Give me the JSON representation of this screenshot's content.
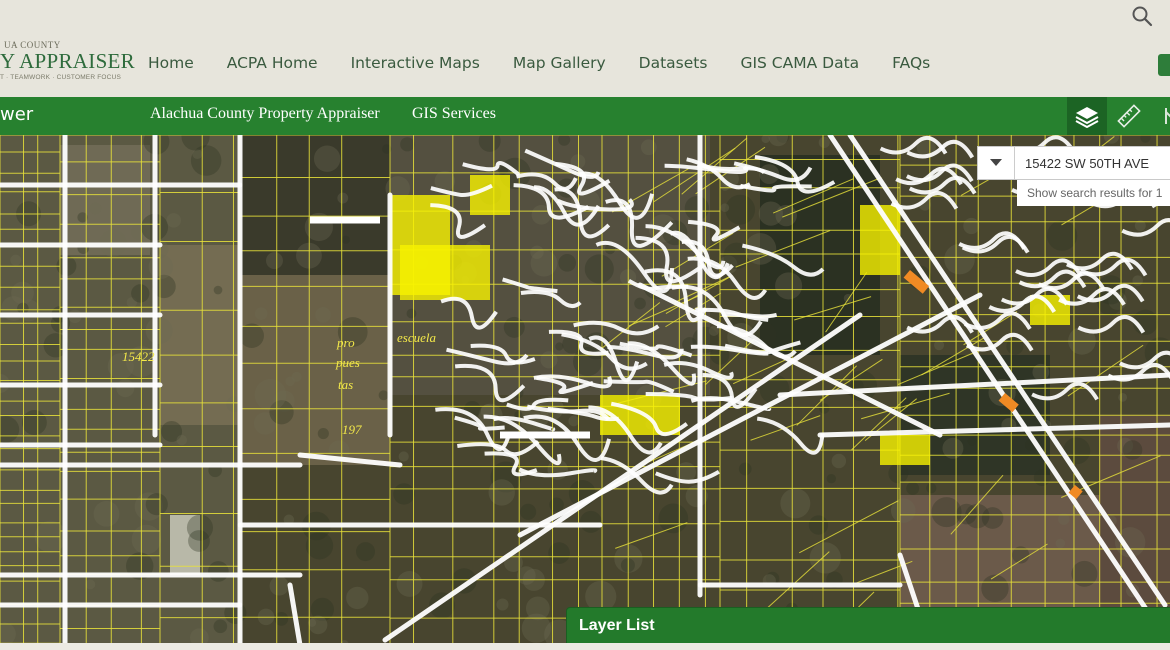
{
  "header": {
    "logo": {
      "county": "UA COUNTY",
      "title": "Y APPRAISER",
      "tagline": "T · TEAMWORK · CUSTOMER FOCUS"
    },
    "nav": [
      "Home",
      "ACPA Home",
      "Interactive Maps",
      "Map Gallery",
      "Datasets",
      "GIS CAMA Data",
      "FAQs"
    ],
    "icons": {
      "search": "search-icon"
    }
  },
  "app_bar": {
    "title": "wer",
    "links": [
      "Alachua County Property Appraiser",
      "GIS Services"
    ],
    "tools": [
      "layers-icon",
      "measure-ruler-icon",
      "more-tool-icon"
    ]
  },
  "map": {
    "labels": {
      "parcel": "15422",
      "propuestas": [
        "pro",
        "pues",
        "tas"
      ],
      "escuela": "escuela",
      "number": "197"
    }
  },
  "search": {
    "value": "15422 SW 50TH AVE",
    "hint": "Show search results for 1"
  },
  "layer_list": {
    "title": "Layer List"
  },
  "colors": {
    "accent_green": "#27812f",
    "parcel_yellow": "#e8e23a",
    "highlight_yellow": "#f7f200",
    "road_white": "#ffffff"
  }
}
